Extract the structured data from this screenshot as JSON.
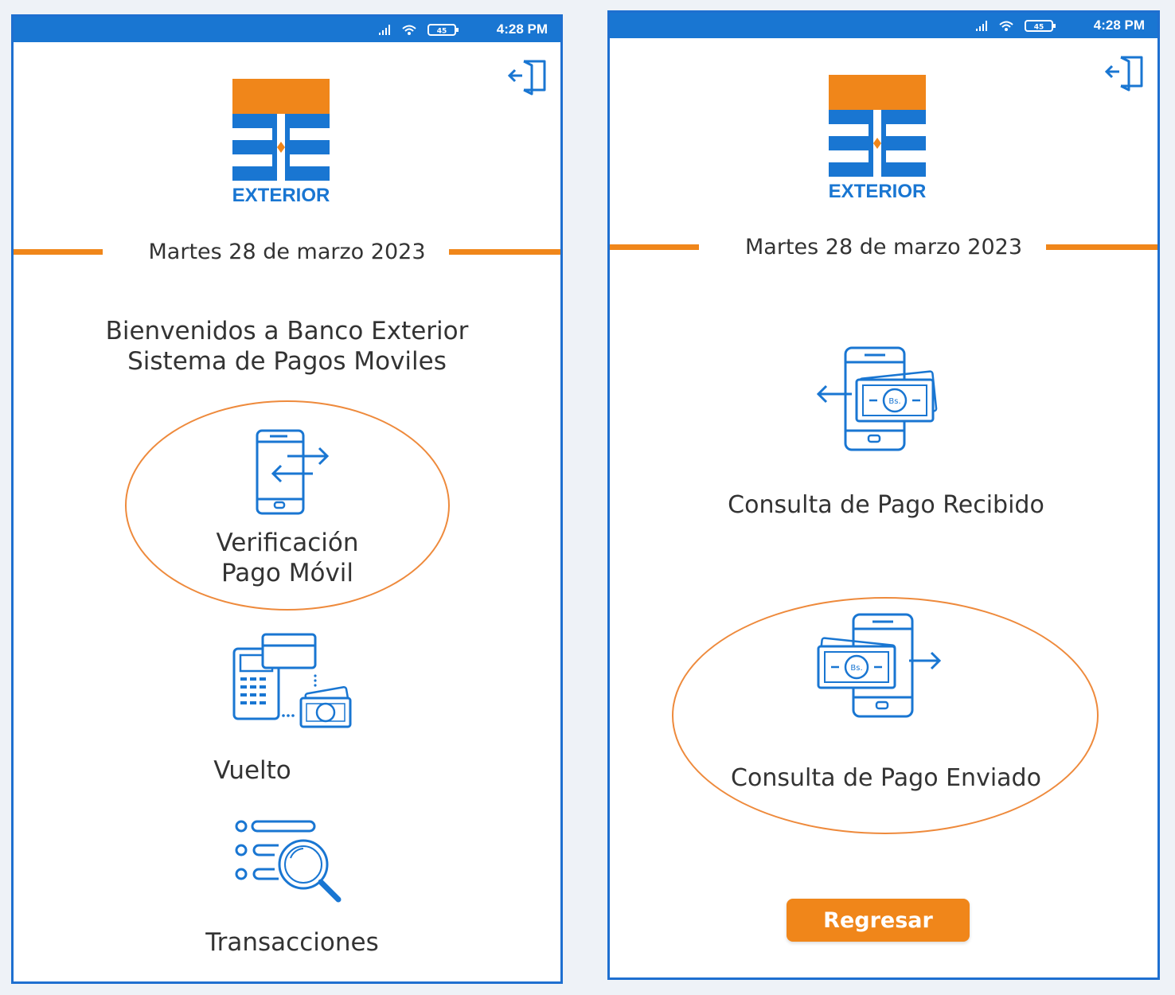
{
  "colors": {
    "brand_blue": "#1976d2",
    "brand_orange": "#f0861a",
    "frame_blue": "#1e6fd0",
    "ring_orange": "#ee8a3c"
  },
  "status_bar": {
    "time": "4:28 PM",
    "battery": "45"
  },
  "logo": {
    "text": "EXTERIOR"
  },
  "left_screen": {
    "date": "Martes 28 de marzo 2023",
    "welcome_line1": "Bienvenidos a Banco Exterior",
    "welcome_line2": "Sistema de Pagos Moviles",
    "menu": {
      "verificacion": {
        "line1": "Verificación",
        "line2": "Pago Móvil",
        "icon": "phone-transfer-icon",
        "highlighted": true
      },
      "vuelto": {
        "label": "Vuelto",
        "icon": "pos-terminal-cash-icon"
      },
      "transacciones": {
        "label": "Transacciones",
        "icon": "search-list-icon"
      }
    }
  },
  "right_screen": {
    "date": "Martes 28 de marzo 2023",
    "menu": {
      "recibido": {
        "label": "Consulta de Pago Recibido",
        "icon": "payment-received-icon"
      },
      "enviado": {
        "label": "Consulta de Pago Enviado",
        "icon": "payment-sent-icon",
        "highlighted": true
      }
    },
    "back_button": "Regresar"
  }
}
